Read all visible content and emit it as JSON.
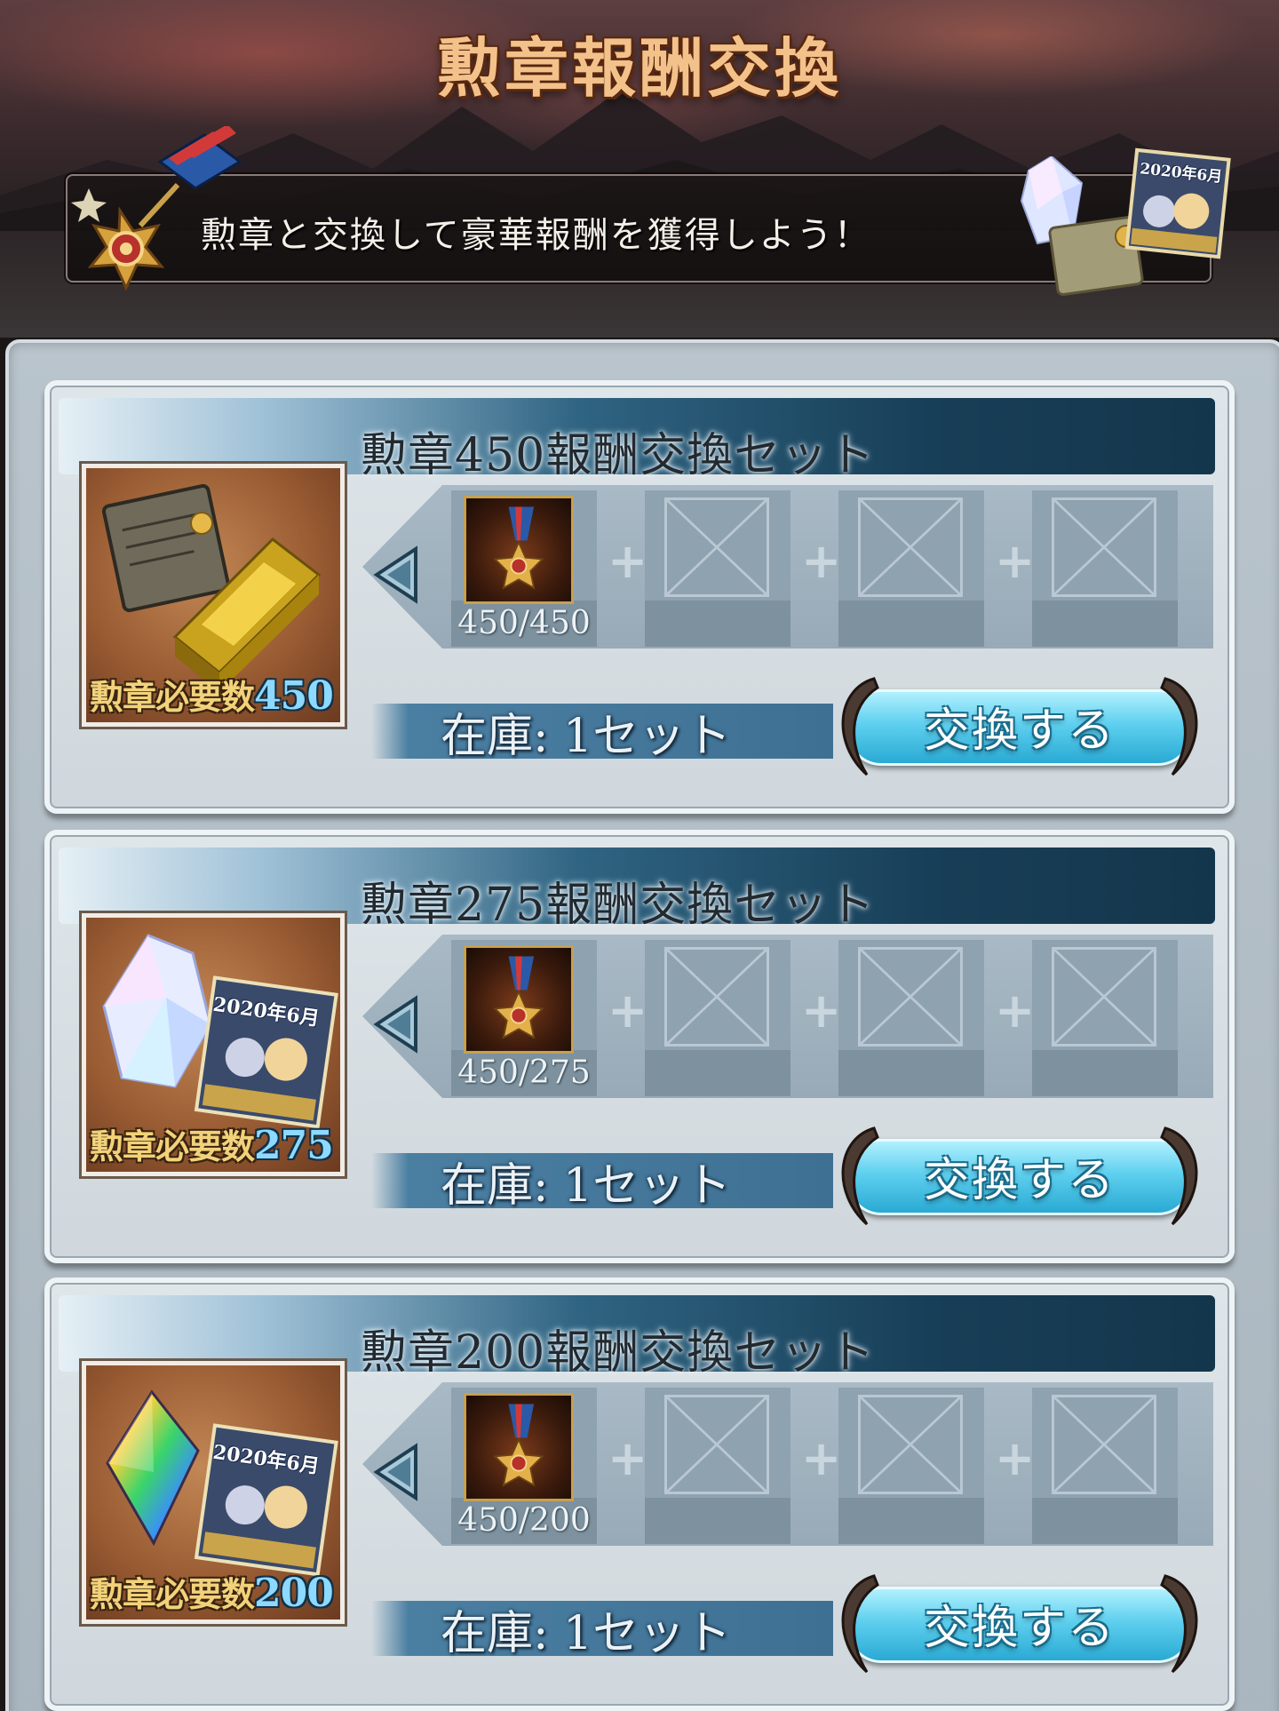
{
  "header": {
    "title": "勲章報酬交換",
    "subtitle": "勲章と交換して豪華報酬を獲得しよう！",
    "ticket_text": "2020年6月"
  },
  "colors": {
    "accent": "#3e7093",
    "button": "#5fd0ef",
    "title_gold": "#f3c18a",
    "medal_frame": "#c7a050"
  },
  "sets": [
    {
      "title": "勲章450報酬交換セット",
      "thumb_icon": "gold-bar-and-scroll-icon",
      "required_label": "勲章必要数",
      "required": "450",
      "medal_count": "450/450",
      "stock": "在庫: 1セット",
      "button": "交換する"
    },
    {
      "title": "勲章275報酬交換セット",
      "thumb_icon": "crystal-and-ticket-icon",
      "required_label": "勲章必要数",
      "required": "275",
      "ticket_text": "2020年6月",
      "medal_count": "450/275",
      "stock": "在庫: 1セット",
      "button": "交換する"
    },
    {
      "title": "勲章200報酬交換セット",
      "thumb_icon": "rainbow-crystal-and-ticket-icon",
      "required_label": "勲章必要数",
      "required": "200",
      "ticket_text": "2020年6月",
      "medal_count": "450/200",
      "stock": "在庫: 1セット",
      "button": "交換する"
    }
  ]
}
